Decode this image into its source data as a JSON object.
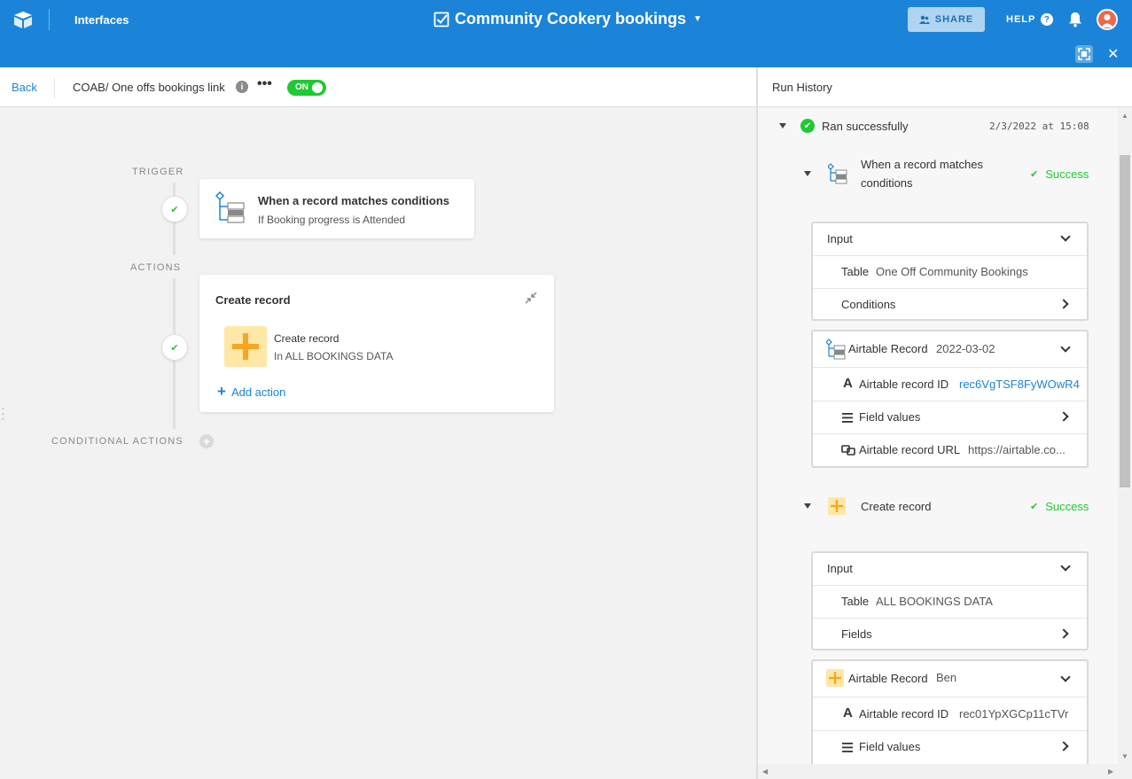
{
  "topbar": {
    "interfaces_label": "Interfaces",
    "base_title": "Community Cookery bookings",
    "share_label": "SHARE",
    "help_label": "HELP"
  },
  "toolbar": {
    "back_label": "Back",
    "automation_name": "COAB/ One offs bookings link",
    "toggle_label": "ON"
  },
  "canvas": {
    "trigger_section_label": "TRIGGER",
    "actions_section_label": "ACTIONS",
    "conditional_section_label": "CONDITIONAL ACTIONS",
    "trigger": {
      "title": "When a record matches conditions",
      "subtitle": "If Booking progress is Attended"
    },
    "action_card": {
      "title": "Create record",
      "action_name": "Create record",
      "action_sub": "In ALL BOOKINGS DATA",
      "add_action_label": "Add action"
    }
  },
  "run_history": {
    "title": "Run History",
    "run_status": "Ran successfully",
    "run_time": "2/3/2022 at 15:08",
    "trigger_step": {
      "name_line1": "When a record matches",
      "name_line2": "conditions",
      "status": "Success",
      "input_label": "Input",
      "table_key": "Table",
      "table_value": "One Off Community Bookings",
      "conditions_label": "Conditions",
      "record_label": "Airtable Record",
      "record_value": "2022-03-02",
      "record_id_key": "Airtable record ID",
      "record_id_value": "rec6VgTSF8FyWOwR4",
      "field_values_label": "Field values",
      "record_url_key": "Airtable record URL",
      "record_url_value": "https://airtable.co..."
    },
    "action_step": {
      "name": "Create record",
      "status": "Success",
      "input_label": "Input",
      "table_key": "Table",
      "table_value": "ALL BOOKINGS DATA",
      "fields_label": "Fields",
      "record_label": "Airtable Record",
      "record_value": "Ben",
      "record_id_key": "Airtable record ID",
      "record_id_value": "rec01YpXGCp11cTVr",
      "field_values_label": "Field values"
    }
  },
  "colors": {
    "topbar": "#1b84d8",
    "success": "#20c933",
    "link": "#1b84d8",
    "action_icon_bg": "#ffe7a6",
    "action_icon_plus": "#f5a623"
  }
}
